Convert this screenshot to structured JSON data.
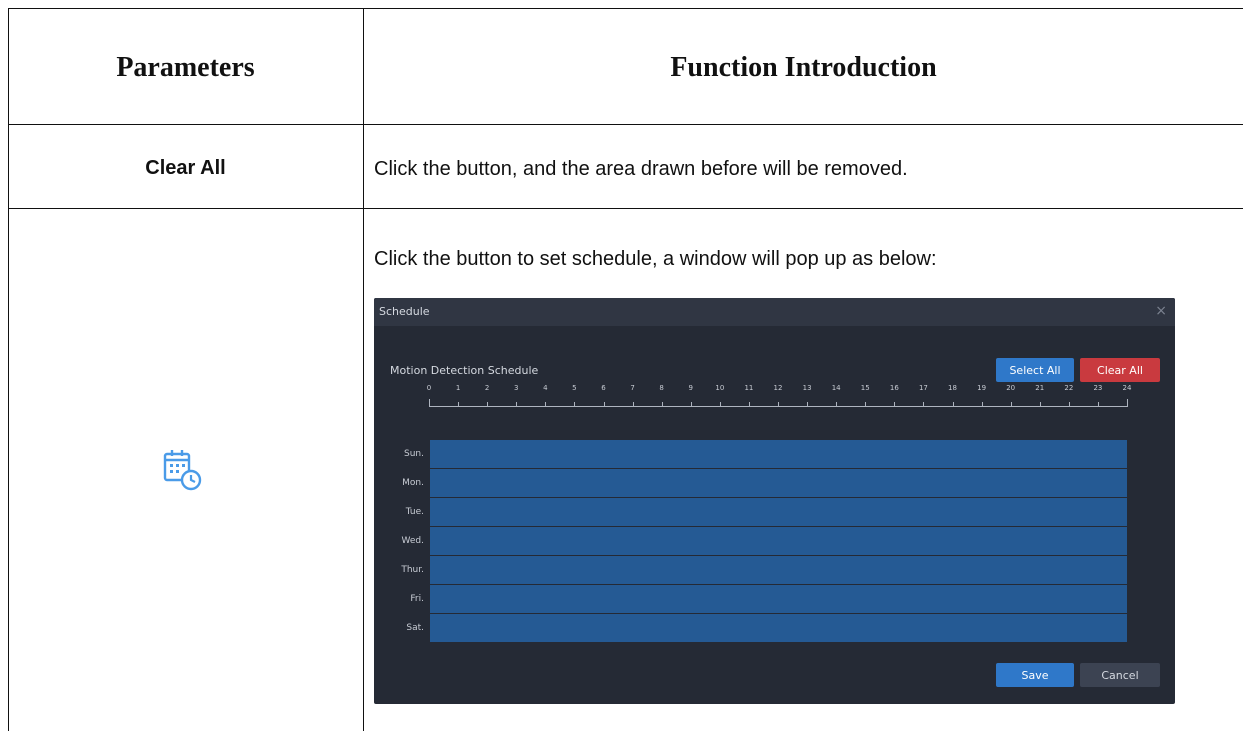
{
  "table": {
    "headers": [
      "Parameters",
      "Function Introduction"
    ],
    "rows": [
      {
        "param": "Clear All",
        "description": "Click the button, and the area drawn before will be removed."
      },
      {
        "param_icon": "calendar-clock-icon",
        "description": "Click the button to set schedule, a window will pop up as below:"
      }
    ]
  },
  "dialog": {
    "title": "Schedule",
    "close_glyph": "×",
    "section_label": "Motion Detection Schedule",
    "select_all_label": "Select All",
    "clear_all_label": "Clear All",
    "hours": [
      "0",
      "1",
      "2",
      "3",
      "4",
      "5",
      "6",
      "7",
      "8",
      "9",
      "10",
      "11",
      "12",
      "13",
      "14",
      "15",
      "16",
      "17",
      "18",
      "19",
      "20",
      "21",
      "22",
      "23",
      "24"
    ],
    "days": [
      "Sun.",
      "Mon.",
      "Tue.",
      "Wed.",
      "Thur.",
      "Fri.",
      "Sat."
    ],
    "selected_fraction": [
      1,
      1,
      1,
      1,
      1,
      1,
      1
    ],
    "save_label": "Save",
    "cancel_label": "Cancel"
  },
  "colors": {
    "dialog_bg": "#252a35",
    "titlebar_bg": "#303643",
    "selection": "#255a94",
    "primary": "#2f78c9",
    "danger": "#c93a3f",
    "icon": "#4a9be8"
  }
}
